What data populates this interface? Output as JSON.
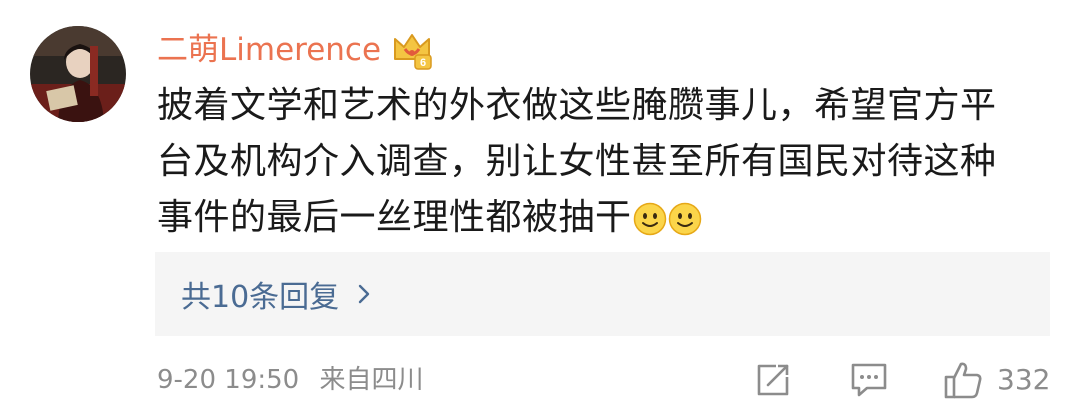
{
  "comment": {
    "username": "二萌Limerence",
    "badge_icon": "crown-badge-icon",
    "badge_level": "6",
    "text_lines": [
      "披着文学和艺术的外衣做这些腌臜事儿，希望官方平",
      "台及机构介入调查，别让女性甚至所有国民对待这种",
      "事件的最后一丝理性都被抽干"
    ],
    "emoji": [
      "smile-emoji",
      "smile-emoji"
    ]
  },
  "replies": {
    "label": "共10条回复"
  },
  "meta": {
    "timestamp": "9-20 19:50",
    "source": "来自四川"
  },
  "actions": {
    "share_icon": "share-icon",
    "comment_icon": "comment-icon",
    "like_icon": "thumbs-up-icon",
    "like_count": "332"
  },
  "colors": {
    "username": "#eb7350",
    "link": "#4a6b93",
    "meta": "#8c8c8c",
    "text": "#1a1a1a",
    "reply_bg": "#f5f5f5"
  }
}
